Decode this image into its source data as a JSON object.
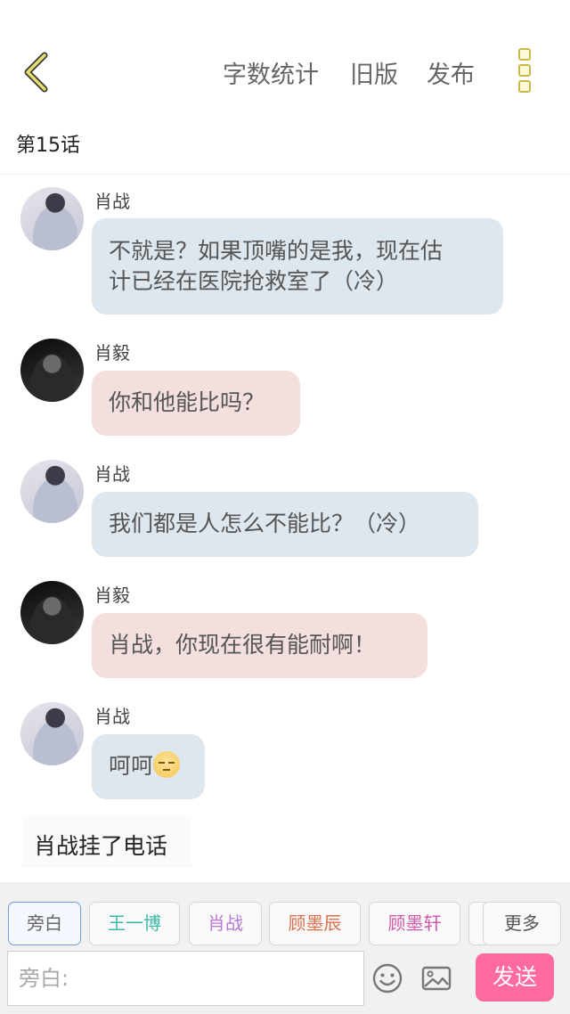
{
  "nav": {
    "word_count": "字数统计",
    "old_version": "旧版",
    "publish": "发布"
  },
  "chapter_title": "第15话",
  "messages": [
    {
      "sender": "肖战",
      "text_lines": [
        "不就是？如果顶嘴的是我，现在估",
        "计已经在医院抢救室了（冷）"
      ],
      "bubble_color": "#dfe7ee"
    },
    {
      "sender": "肖毅",
      "text": "你和他能比吗？",
      "bubble_color": "#f4dfdf"
    },
    {
      "sender": "肖战",
      "text": "我们都是人怎么不能比？（冷）",
      "bubble_color": "#dfe7ee"
    },
    {
      "sender": "肖毅",
      "text": "肖战，你现在很有能耐啊！",
      "bubble_color": "#f4dfdf"
    },
    {
      "sender": "肖战",
      "text": "呵呵",
      "emoji": "unamused-face",
      "bubble_color": "#dfe7ee"
    }
  ],
  "narration": "肖战挂了电话",
  "role_tabs": [
    {
      "label": "旁白",
      "color": "#666666",
      "selected": true
    },
    {
      "label": "王一博",
      "color": "#3bb8a8",
      "selected": false
    },
    {
      "label": "肖战",
      "color": "#b97ad6",
      "selected": false
    },
    {
      "label": "顾墨辰",
      "color": "#d9704e",
      "selected": false
    },
    {
      "label": "顾墨轩",
      "color": "#d05aa8",
      "selected": false
    },
    {
      "label": "更多",
      "color": "#555555",
      "selected": false
    }
  ],
  "input": {
    "placeholder": "旁白:"
  },
  "send_label": "发送",
  "colors": {
    "accent_pink": "#ff6aa0",
    "back_arrow": "#c9b84a"
  }
}
